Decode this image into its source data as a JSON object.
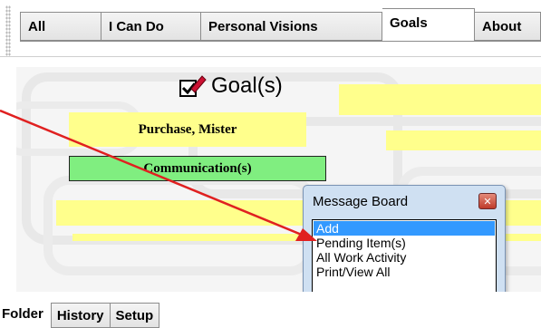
{
  "top_tabs": [
    {
      "label": "All"
    },
    {
      "label": "I Can Do"
    },
    {
      "label": "Personal Visions"
    },
    {
      "label": "Goals"
    },
    {
      "label": "About"
    }
  ],
  "goal_header": {
    "title": "Goal(s)",
    "icon": "checkbox-pencil-icon"
  },
  "labels": {
    "purchase": "Purchase, Mister",
    "communication": "Communication(s)"
  },
  "message_board": {
    "title": "Message Board",
    "close_icon": "close-icon",
    "items": [
      {
        "label": "Add"
      },
      {
        "label": "Pending Item(s)"
      },
      {
        "label": "All Work Activity"
      },
      {
        "label": "Print/View All"
      }
    ]
  },
  "bottom_tabs": [
    {
      "label": "Folder"
    },
    {
      "label": "History"
    },
    {
      "label": "Setup"
    }
  ],
  "colors": {
    "highlight": "#3399ff",
    "annotation_arrow": "#e02020",
    "yellow_field": "#ffff8c",
    "green_field": "#80ee80"
  }
}
